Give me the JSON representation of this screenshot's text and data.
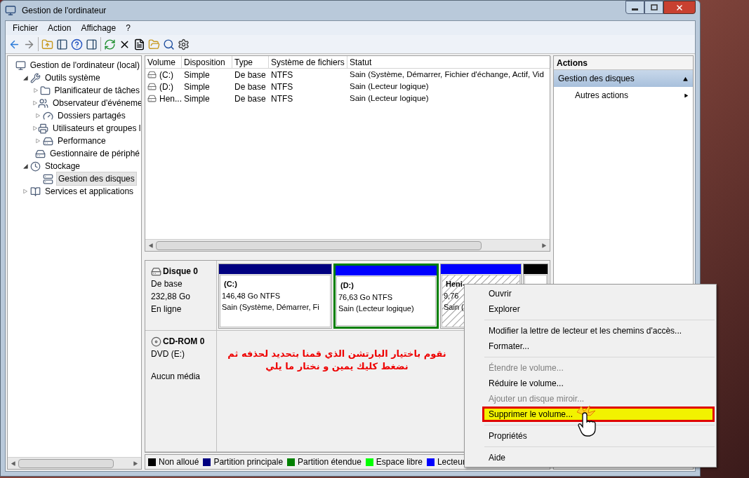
{
  "window": {
    "title": "Gestion de l'ordinateur"
  },
  "menu": [
    "Fichier",
    "Action",
    "Affichage",
    "?"
  ],
  "tree": [
    {
      "label": "Gestion de l'ordinateur (local)",
      "selected": false,
      "children": [
        {
          "label": "Outils système",
          "expanded": true,
          "selected": false,
          "children": [
            {
              "label": "Planificateur de tâches",
              "expanded": false,
              "selected": false
            },
            {
              "label": "Observateur d'événeme",
              "expanded": false,
              "selected": false
            },
            {
              "label": "Dossiers partagés",
              "expanded": false,
              "selected": false
            },
            {
              "label": "Utilisateurs et groupes l",
              "expanded": false,
              "selected": false
            },
            {
              "label": "Performance",
              "expanded": false,
              "selected": false
            },
            {
              "label": "Gestionnaire de périphé",
              "selected": false
            }
          ]
        },
        {
          "label": "Stockage",
          "expanded": true,
          "selected": false,
          "children": [
            {
              "label": "Gestion des disques",
              "selected": true
            }
          ]
        },
        {
          "label": "Services et applications",
          "expanded": false,
          "selected": false
        }
      ]
    }
  ],
  "volumes": {
    "columns": [
      "Volume",
      "Disposition",
      "Type",
      "Système de fichiers",
      "Statut"
    ],
    "rows": [
      [
        "(C:)",
        "Simple",
        "De base",
        "NTFS",
        "Sain (Système, Démarrer, Fichier d'échange, Actif, Vid"
      ],
      [
        "(D:)",
        "Simple",
        "De base",
        "NTFS",
        "Sain (Lecteur logique)"
      ],
      [
        "Hen...",
        "Simple",
        "De base",
        "NTFS",
        "Sain (Lecteur logique)"
      ]
    ]
  },
  "disks": [
    {
      "kind": "disk",
      "name": "Disque 0",
      "lines": [
        "De base",
        "232,88 Go",
        "En ligne"
      ],
      "partitions": [
        {
          "name": "(C:)",
          "size": "146,48 Go NTFS",
          "status": "Sain (Système, Démarrer, Fi",
          "color": "#000080",
          "selected": false,
          "hatched": false
        },
        {
          "name": "(D:)",
          "size": "76,63 Go NTFS",
          "status": "Sain (Lecteur logique)",
          "color": "#0000ff",
          "selected": true,
          "hatched": false
        },
        {
          "name": "Heni-",
          "size": "9,76",
          "status": "Sain (",
          "color": "#0000ff",
          "selected": false,
          "hatched": true
        },
        {
          "color": "#000000",
          "selected": false,
          "hatched": false
        }
      ]
    },
    {
      "kind": "cdrom",
      "name": "CD-ROM 0",
      "lines": [
        "DVD (E:)",
        "Aucun média"
      ]
    }
  ],
  "annotation": [
    "نقوم باختيار البارتشن الذي قمنا بتحديد لحذفه ثم",
    "نضغط كليك يمين و نختار ما يلي"
  ],
  "legend": [
    {
      "label": "Non alloué",
      "color": "#000000"
    },
    {
      "label": "Partition principale",
      "color": "#000080"
    },
    {
      "label": "Partition étendue",
      "color": "#008000"
    },
    {
      "label": "Espace libre",
      "color": "#00ff00"
    },
    {
      "label": "Lecteur",
      "color": "#0000ff"
    }
  ],
  "actions": {
    "title": "Actions",
    "section": {
      "label": "Gestion des disques",
      "expanded": true
    },
    "items": [
      "Autres actions"
    ]
  },
  "context_menu": [
    {
      "kind": "item",
      "label": "Ouvrir",
      "disabled": false,
      "selected": false
    },
    {
      "kind": "item",
      "label": "Explorer",
      "disabled": false,
      "selected": false
    },
    {
      "kind": "separator"
    },
    {
      "kind": "item",
      "label": "Modifier la lettre de lecteur et les chemins d'accès...",
      "disabled": false,
      "selected": false
    },
    {
      "kind": "item",
      "label": "Formater...",
      "disabled": false,
      "selected": false
    },
    {
      "kind": "separator"
    },
    {
      "kind": "item",
      "label": "Étendre le volume...",
      "disabled": true,
      "selected": false
    },
    {
      "kind": "item",
      "label": "Réduire le volume...",
      "disabled": false,
      "selected": false
    },
    {
      "kind": "item",
      "label": "Ajouter un disque miroir...",
      "disabled": true,
      "selected": false
    },
    {
      "kind": "item",
      "label": "Supprimer le volume...",
      "disabled": false,
      "selected": true
    },
    {
      "kind": "separator"
    },
    {
      "kind": "item",
      "label": "Propriétés",
      "disabled": false,
      "selected": false
    },
    {
      "kind": "separator"
    },
    {
      "kind": "item",
      "label": "Aide",
      "disabled": false,
      "selected": false
    }
  ]
}
